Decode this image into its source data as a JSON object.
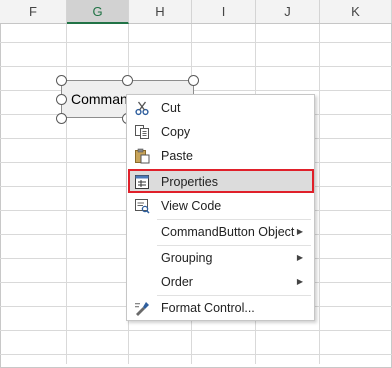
{
  "columns": [
    {
      "label": "F"
    },
    {
      "label": "G"
    },
    {
      "label": "H"
    },
    {
      "label": "I"
    },
    {
      "label": "J"
    },
    {
      "label": "K"
    }
  ],
  "selected_column": "G",
  "command_button": {
    "label": "Comman"
  },
  "context_menu": {
    "items": [
      {
        "label": "Cut",
        "icon": "scissors-icon"
      },
      {
        "label": "Copy",
        "icon": "copy-icon"
      },
      {
        "label": "Paste",
        "icon": "paste-icon"
      },
      {
        "label": "Properties",
        "icon": "properties-icon",
        "highlighted": true
      },
      {
        "label": "View Code",
        "icon": "view-code-icon"
      },
      {
        "label": "CommandButton Object",
        "submenu": true
      },
      {
        "label": "Grouping",
        "submenu": true
      },
      {
        "label": "Order",
        "submenu": true
      },
      {
        "label": "Format Control...",
        "icon": "format-control-icon"
      }
    ]
  },
  "colors": {
    "highlight_border": "#e0202a",
    "selected_header_text": "#217346"
  }
}
